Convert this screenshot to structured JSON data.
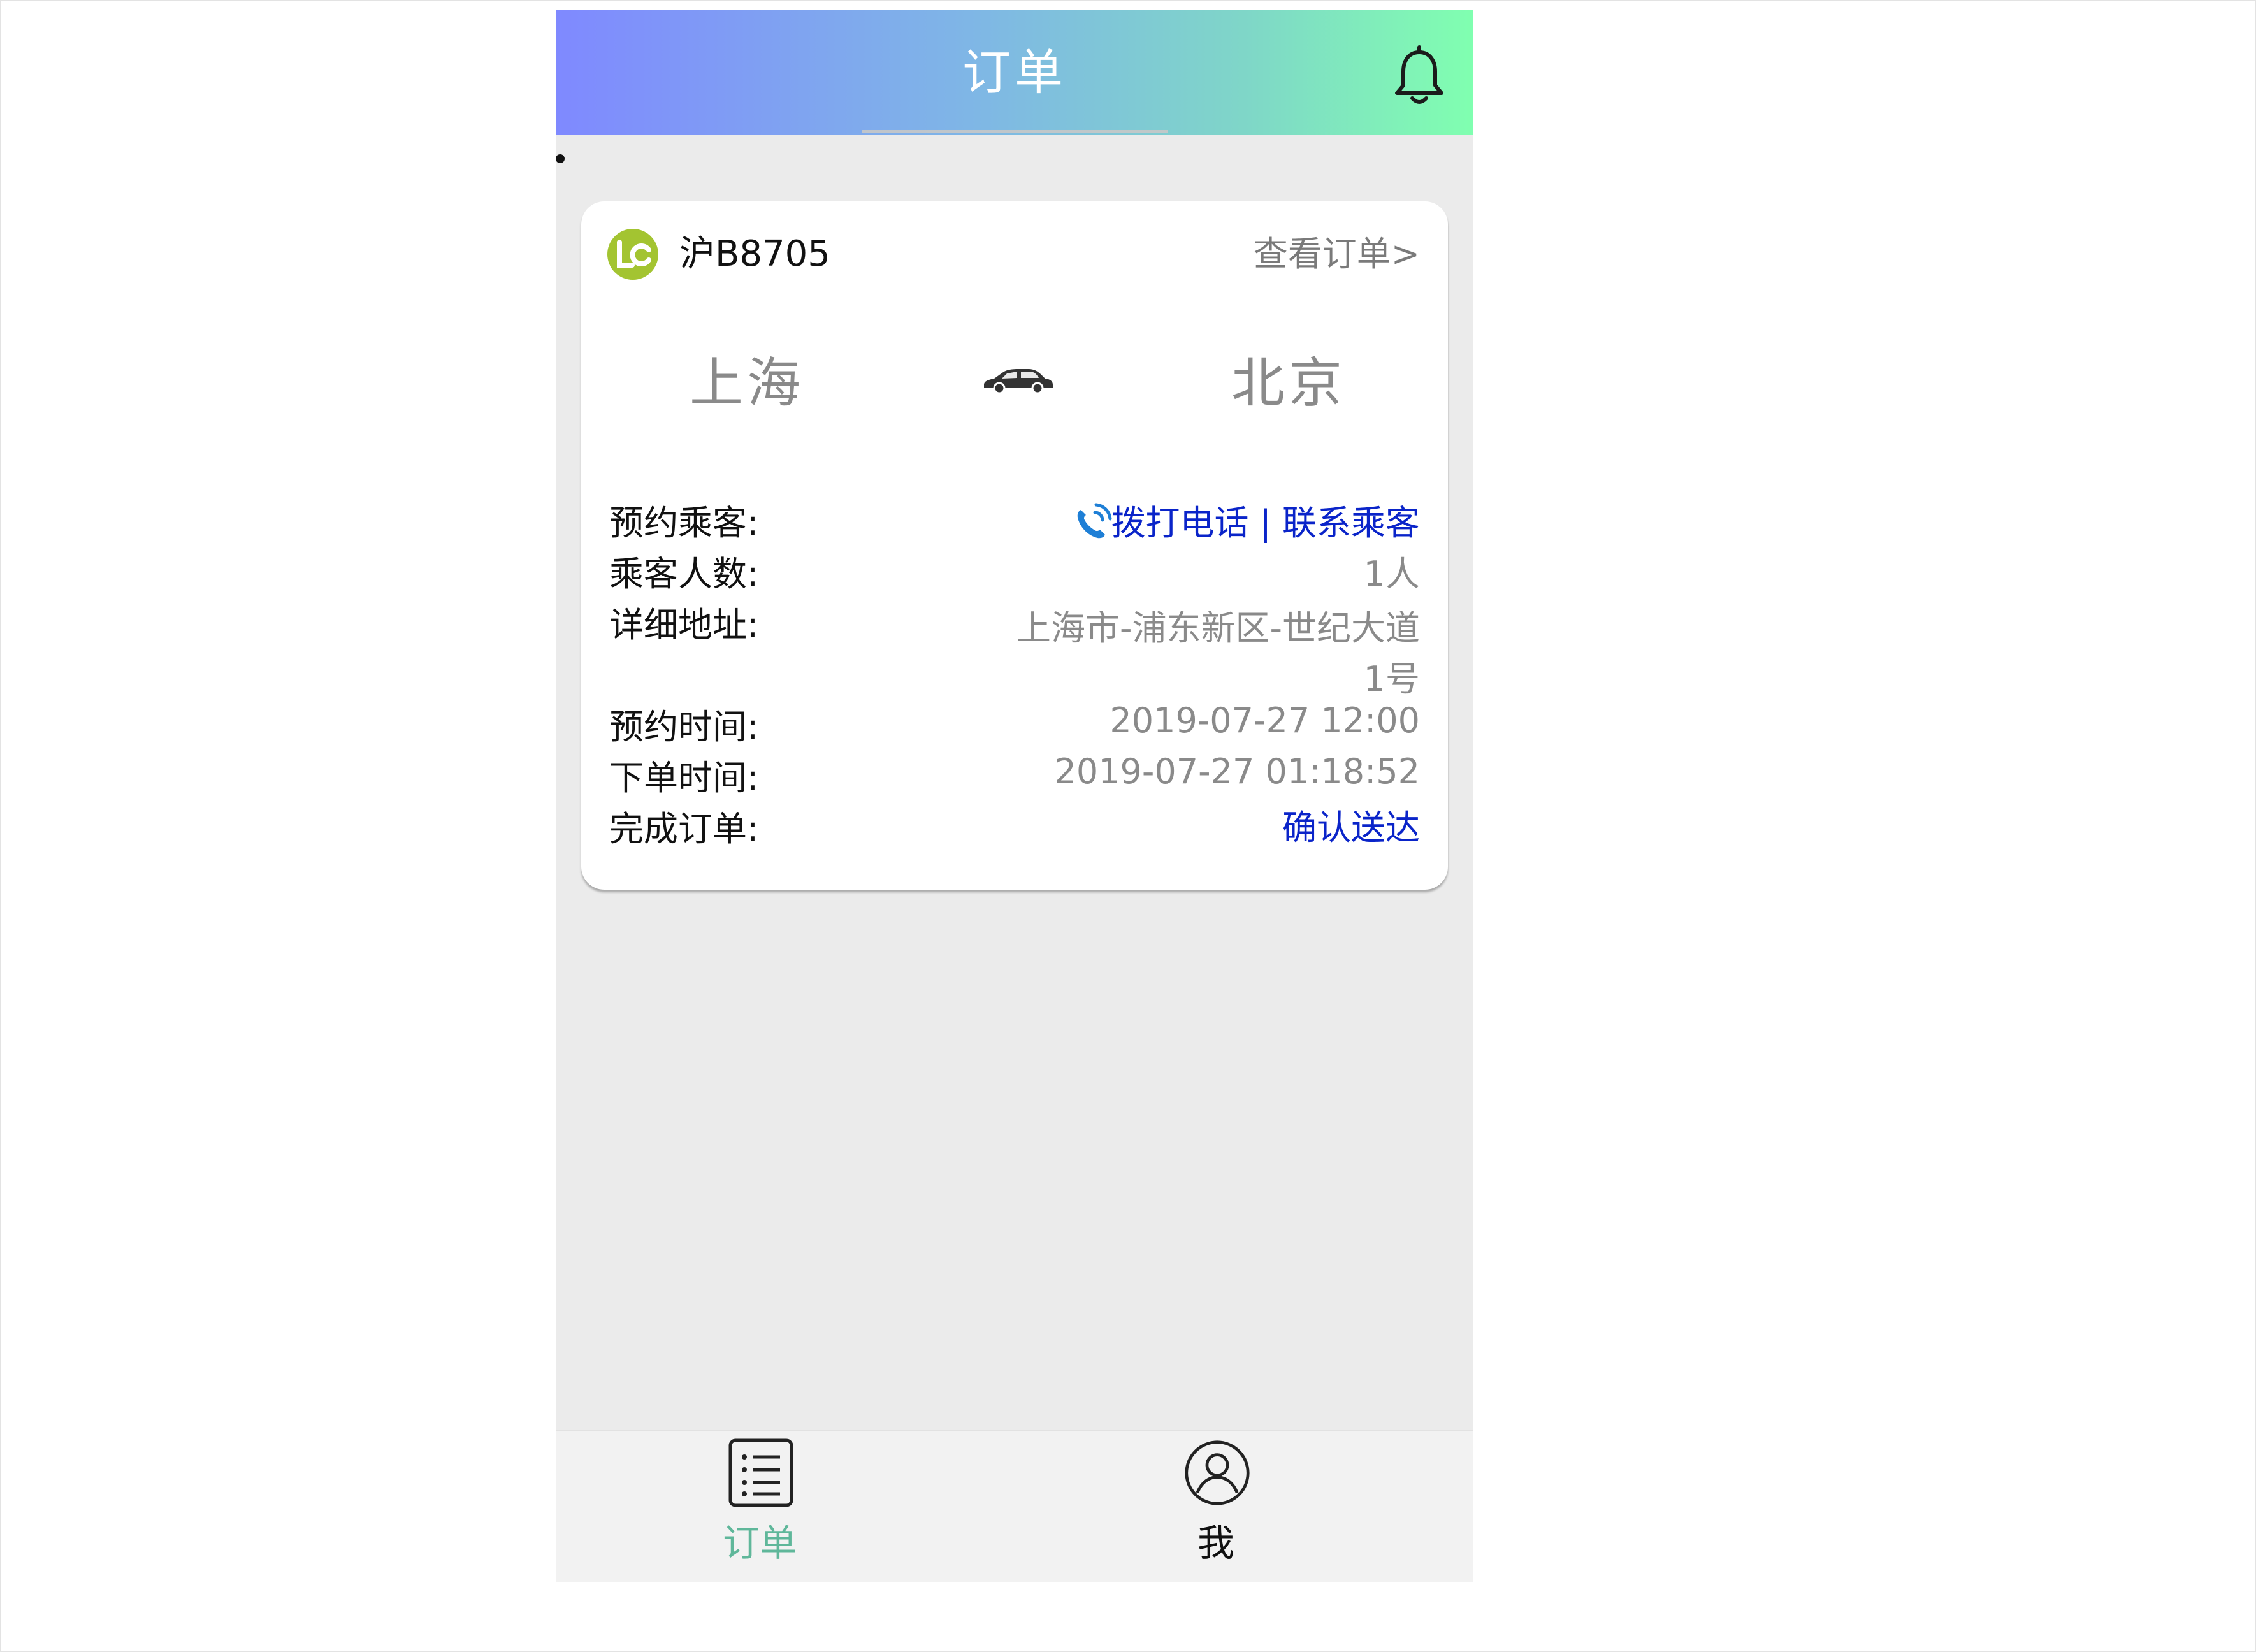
{
  "header": {
    "title": "订单"
  },
  "order_card": {
    "plate": "沪B8705",
    "view_order_link": "查看订单>",
    "origin": "上海",
    "destination": "北京",
    "rows": {
      "passenger": {
        "label": "预约乘客:",
        "action_label": "拨打电话 | 联系乘客"
      },
      "count": {
        "label": "乘客人数:",
        "value": "1人"
      },
      "address": {
        "label": "详细地址:",
        "value": "上海市-浦东新区-世纪大道1号"
      },
      "appointment_time": {
        "label": "预约时间:",
        "value": "2019-07-27 12:00"
      },
      "order_time": {
        "label": "下单时间:",
        "value": "2019-07-27 01:18:52"
      },
      "complete": {
        "label": "完成订单:",
        "action_label": "确认送达"
      }
    }
  },
  "tabbar": {
    "tabs": [
      {
        "label": "订单",
        "icon": "list-icon",
        "active": true
      },
      {
        "label": "我",
        "icon": "user-icon",
        "active": false
      }
    ]
  },
  "colors": {
    "header_gradient_start": "#7f89ff",
    "header_gradient_end": "#80ffb0",
    "link_blue": "#0a24c9",
    "active_tab": "#5fb79a",
    "logo_green": "#a3c431"
  }
}
